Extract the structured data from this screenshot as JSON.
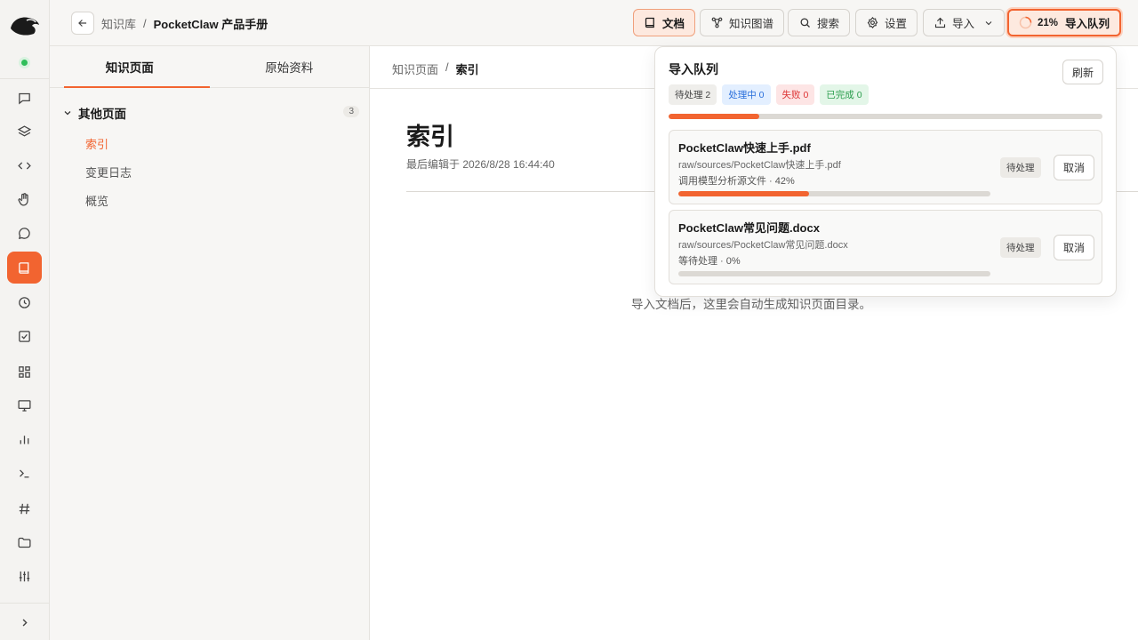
{
  "topbar": {
    "breadcrumb_root": "知识库",
    "breadcrumb_sep": "/",
    "breadcrumb_current": "PocketClaw 产品手册",
    "buttons": {
      "docs": "文档",
      "graph": "知识图谱",
      "search": "搜索",
      "settings": "设置",
      "import": "导入",
      "queue_percent": "21%",
      "queue_label": "导入队列"
    }
  },
  "leftpane": {
    "tabs": [
      "知识页面",
      "原始资料"
    ],
    "active_tab": 0,
    "group": {
      "label": "其他页面",
      "count": "3"
    },
    "pages": [
      "索引",
      "变更日志",
      "概览"
    ],
    "active_page": 0
  },
  "main": {
    "breadcrumb_root": "知识页面",
    "breadcrumb_sep": "/",
    "breadcrumb_current": "索引",
    "title": "索引",
    "meta": "最后编辑于 2026/8/28 16:44:40",
    "empty_message": "导入文档后，这里会自动生成知识页面目录。"
  },
  "queue": {
    "title": "导入队列",
    "refresh_label": "刷新",
    "badges": {
      "pending": "待处理 2",
      "processing": "处理中 0",
      "failed": "失败 0",
      "completed": "已完成 0"
    },
    "overall_progress": 0.21,
    "items": [
      {
        "name": "PocketClaw快速上手.pdf",
        "path": "raw/sources/PocketClaw快速上手.pdf",
        "status": "调用模型分析源文件 · 42%",
        "progress": 0.42,
        "tag": "待处理",
        "cancel": "取消"
      },
      {
        "name": "PocketClaw常见问题.docx",
        "path": "raw/sources/PocketClaw常见问题.docx",
        "status": "等待处理 · 0%",
        "progress": 0,
        "tag": "待处理",
        "cancel": "取消"
      }
    ]
  },
  "colors": {
    "accent": "#f26430",
    "online": "#2fbe5a"
  }
}
